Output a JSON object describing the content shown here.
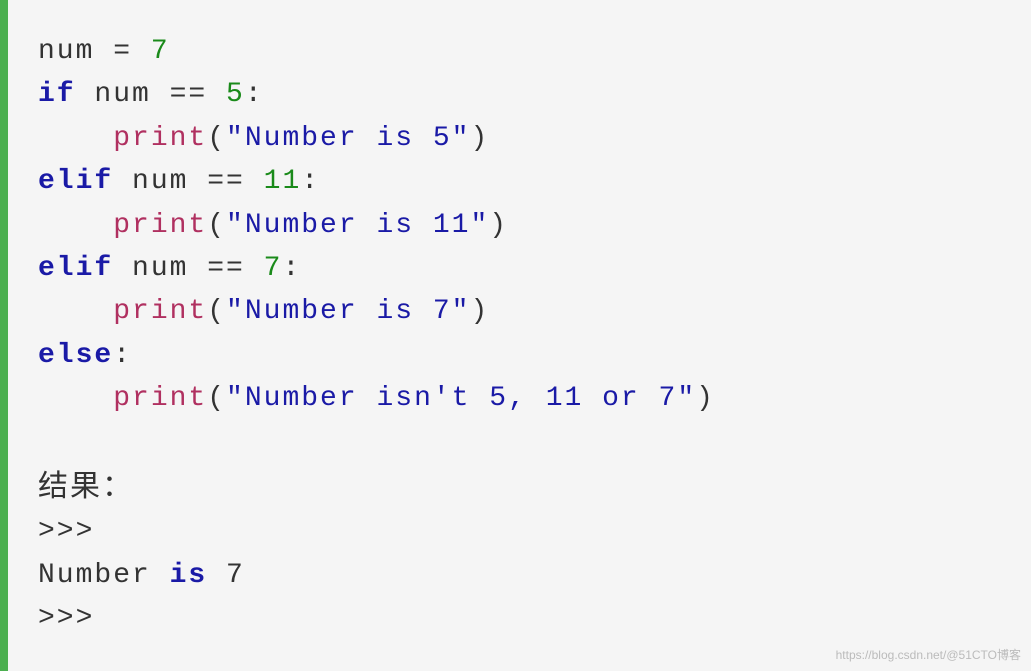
{
  "code": {
    "l1": {
      "ident": "num ",
      "eq": "= ",
      "val": "7"
    },
    "l2": {
      "kw": "if",
      "rest": " num == ",
      "val": "5",
      "colon": ":"
    },
    "l3": {
      "indent": "    ",
      "fn": "print",
      "lp": "(",
      "str": "\"Number is 5\"",
      "rp": ")"
    },
    "l4": {
      "kw": "elif",
      "rest": " num == ",
      "val": "11",
      "colon": ":"
    },
    "l5": {
      "indent": "    ",
      "fn": "print",
      "lp": "(",
      "str": "\"Number is 11\"",
      "rp": ")"
    },
    "l6": {
      "kw": "elif",
      "rest": " num == ",
      "val": "7",
      "colon": ":"
    },
    "l7": {
      "indent": "    ",
      "fn": "print",
      "lp": "(",
      "str": "\"Number is 7\"",
      "rp": ")"
    },
    "l8": {
      "kw": "else",
      "colon": ":"
    },
    "l9": {
      "indent": "    ",
      "fn": "print",
      "lp": "(",
      "str": "\"Number isn't 5, 11 or 7\"",
      "rp": ")"
    }
  },
  "result_label": "结果：",
  "output": {
    "p1": ">>>",
    "line_pre": "Number ",
    "line_kw": "is",
    "line_post": " 7",
    "p2": ">>>"
  },
  "watermark": "https://blog.csdn.net/@51CTO博客"
}
